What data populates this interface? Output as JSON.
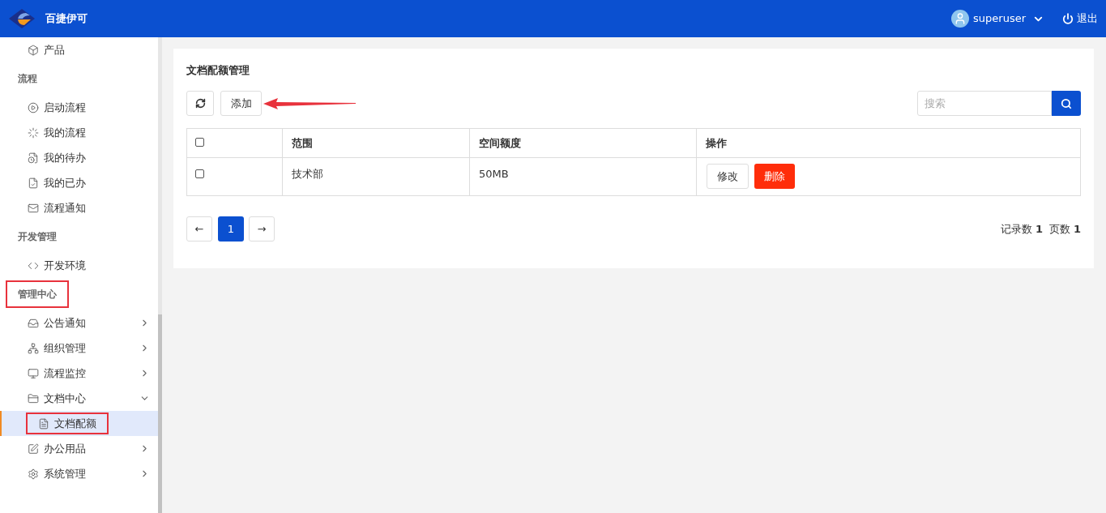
{
  "header": {
    "brand": "百捷伊可",
    "user": "superuser",
    "logout": "退出"
  },
  "sidebar": {
    "entries": [
      {
        "kind": "item",
        "label": "产品",
        "selected": false,
        "highlighted": false
      },
      {
        "kind": "section",
        "label": "流程",
        "highlighted": false
      },
      {
        "kind": "item",
        "label": "启动流程",
        "selected": false,
        "highlighted": false
      },
      {
        "kind": "item",
        "label": "我的流程",
        "selected": false,
        "highlighted": false
      },
      {
        "kind": "item",
        "label": "我的待办",
        "selected": false,
        "highlighted": false
      },
      {
        "kind": "item",
        "label": "我的已办",
        "selected": false,
        "highlighted": false
      },
      {
        "kind": "item",
        "label": "流程通知",
        "selected": false,
        "highlighted": false
      },
      {
        "kind": "section",
        "label": "开发管理",
        "highlighted": false
      },
      {
        "kind": "item",
        "label": "开发环境",
        "selected": false,
        "highlighted": false
      },
      {
        "kind": "section",
        "label": "管理中心",
        "highlighted": true
      },
      {
        "kind": "item",
        "label": "公告通知",
        "expandable": true,
        "expanded": false,
        "selected": false,
        "highlighted": false
      },
      {
        "kind": "item",
        "label": "组织管理",
        "expandable": true,
        "expanded": false,
        "selected": false,
        "highlighted": false
      },
      {
        "kind": "item",
        "label": "流程监控",
        "expandable": true,
        "expanded": false,
        "selected": false,
        "highlighted": false
      },
      {
        "kind": "item",
        "label": "文档中心",
        "expandable": true,
        "expanded": true,
        "selected": false,
        "highlighted": false,
        "children": [
          {
            "label": "文档配额",
            "selected": true,
            "highlighted": true
          }
        ]
      },
      {
        "kind": "item",
        "label": "办公用品",
        "expandable": true,
        "expanded": false,
        "selected": false,
        "highlighted": false
      },
      {
        "kind": "item",
        "label": "系统管理",
        "expandable": true,
        "expanded": false,
        "selected": false,
        "highlighted": false
      }
    ]
  },
  "panel": {
    "title": "文档配额管理",
    "add_button": "添加",
    "search": {
      "placeholder": "搜索"
    },
    "table": {
      "columns": [
        "范围",
        "空间额度",
        "操作"
      ],
      "header_checked": false,
      "rows": [
        {
          "checked": false,
          "scope": "技术部",
          "quota": "50MB",
          "actions": [
            "修改",
            "删除"
          ]
        }
      ]
    },
    "pagination": {
      "prev": "←",
      "pages": [
        {
          "label": "1",
          "selected": true
        }
      ],
      "next": "→"
    },
    "summary": {
      "records_label": "记录数",
      "records": "1",
      "pages_label": "页数",
      "pages": "1"
    }
  }
}
